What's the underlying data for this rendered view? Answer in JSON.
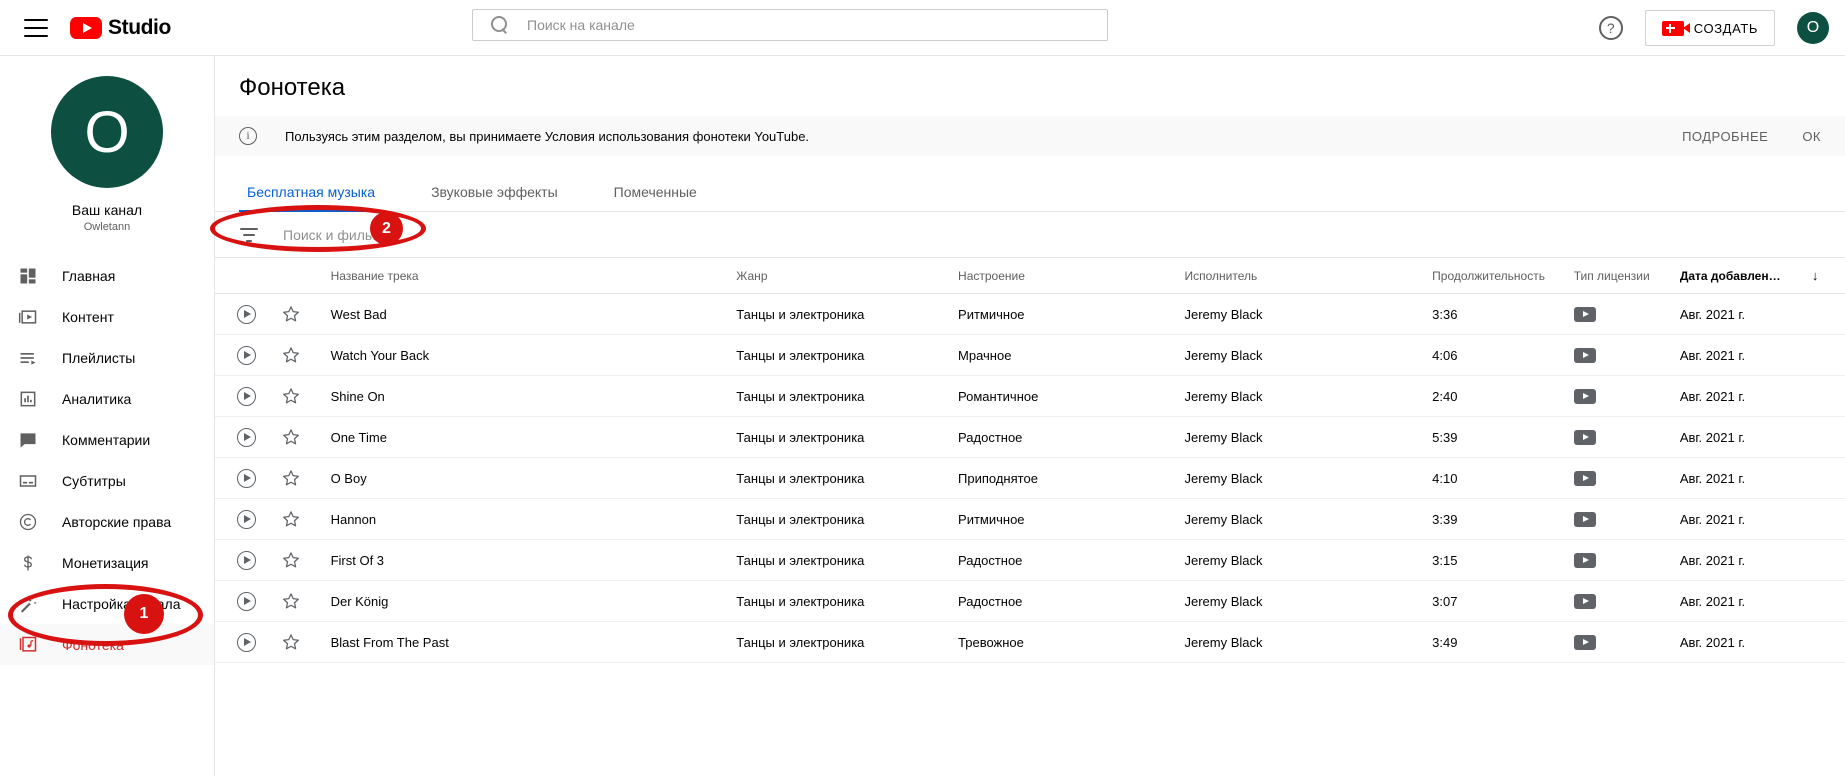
{
  "topbar": {
    "menu_icon": "hamburger-icon",
    "brand": "Studio",
    "search_placeholder": "Поиск на канале",
    "search_value": "",
    "help_glyph": "?",
    "create_label": "СОЗДАТЬ",
    "avatar_letter": "O"
  },
  "sidebar": {
    "avatar_letter": "O",
    "channel_name": "Ваш канал",
    "channel_handle": "Owletann",
    "items": [
      {
        "label": "Главная",
        "icon": "dashboard-icon",
        "active": false
      },
      {
        "label": "Контент",
        "icon": "video-icon",
        "active": false
      },
      {
        "label": "Плейлисты",
        "icon": "playlist-icon",
        "active": false
      },
      {
        "label": "Аналитика",
        "icon": "analytics-icon",
        "active": false
      },
      {
        "label": "Комментарии",
        "icon": "comment-icon",
        "active": false
      },
      {
        "label": "Субтитры",
        "icon": "subtitles-icon",
        "active": false
      },
      {
        "label": "Авторские права",
        "icon": "copyright-icon",
        "active": false
      },
      {
        "label": "Монетизация",
        "icon": "dollar-icon",
        "active": false
      },
      {
        "label": "Настройка канала",
        "icon": "magic-wand-icon",
        "active": false
      },
      {
        "label": "Фонотека",
        "icon": "audio-library-icon",
        "active": true
      }
    ]
  },
  "main": {
    "page_title": "Фонотека",
    "notice": {
      "text": "Пользуясь этим разделом, вы принимаете Условия использования фонотеки YouTube.",
      "more_label": "ПОДРОБНЕЕ",
      "ok_label": "ОК"
    },
    "tabs": [
      {
        "label": "Бесплатная музыка",
        "active": true
      },
      {
        "label": "Звуковые эффекты",
        "active": false
      },
      {
        "label": "Помеченные",
        "active": false
      }
    ],
    "filter": {
      "placeholder": "Поиск и фильтры",
      "value": ""
    },
    "table": {
      "headers": {
        "title": "Название трека",
        "genre": "Жанр",
        "mood": "Настроение",
        "artist": "Исполнитель",
        "duration": "Продолжительность",
        "license": "Тип лицензии",
        "date": "Дата добавлен…",
        "sort_arrow": "↓"
      },
      "rows": [
        {
          "title": "West Bad",
          "genre": "Танцы и электроника",
          "mood": "Ритмичное",
          "artist": "Jeremy Black",
          "duration": "3:36",
          "date": "Авг. 2021 г."
        },
        {
          "title": "Watch Your Back",
          "genre": "Танцы и электроника",
          "mood": "Мрачное",
          "artist": "Jeremy Black",
          "duration": "4:06",
          "date": "Авг. 2021 г."
        },
        {
          "title": "Shine On",
          "genre": "Танцы и электроника",
          "mood": "Романтичное",
          "artist": "Jeremy Black",
          "duration": "2:40",
          "date": "Авг. 2021 г."
        },
        {
          "title": "One Time",
          "genre": "Танцы и электроника",
          "mood": "Радостное",
          "artist": "Jeremy Black",
          "duration": "5:39",
          "date": "Авг. 2021 г."
        },
        {
          "title": "O Boy",
          "genre": "Танцы и электроника",
          "mood": "Приподнятое",
          "artist": "Jeremy Black",
          "duration": "4:10",
          "date": "Авг. 2021 г."
        },
        {
          "title": "Hannon",
          "genre": "Танцы и электроника",
          "mood": "Ритмичное",
          "artist": "Jeremy Black",
          "duration": "3:39",
          "date": "Авг. 2021 г."
        },
        {
          "title": "First Of 3",
          "genre": "Танцы и электроника",
          "mood": "Радостное",
          "artist": "Jeremy Black",
          "duration": "3:15",
          "date": "Авг. 2021 г."
        },
        {
          "title": "Der König",
          "genre": "Танцы и электроника",
          "mood": "Радостное",
          "artist": "Jeremy Black",
          "duration": "3:07",
          "date": "Авг. 2021 г."
        },
        {
          "title": "Blast From The Past",
          "genre": "Танцы и электроника",
          "mood": "Тревожное",
          "artist": "Jeremy Black",
          "duration": "3:49",
          "date": "Авг. 2021 г."
        }
      ]
    }
  },
  "annotations": {
    "color": "#d81111",
    "markers": [
      {
        "id": "1",
        "target": "sidebar-item-audio-library"
      },
      {
        "id": "2",
        "target": "filter-search-input"
      }
    ]
  }
}
